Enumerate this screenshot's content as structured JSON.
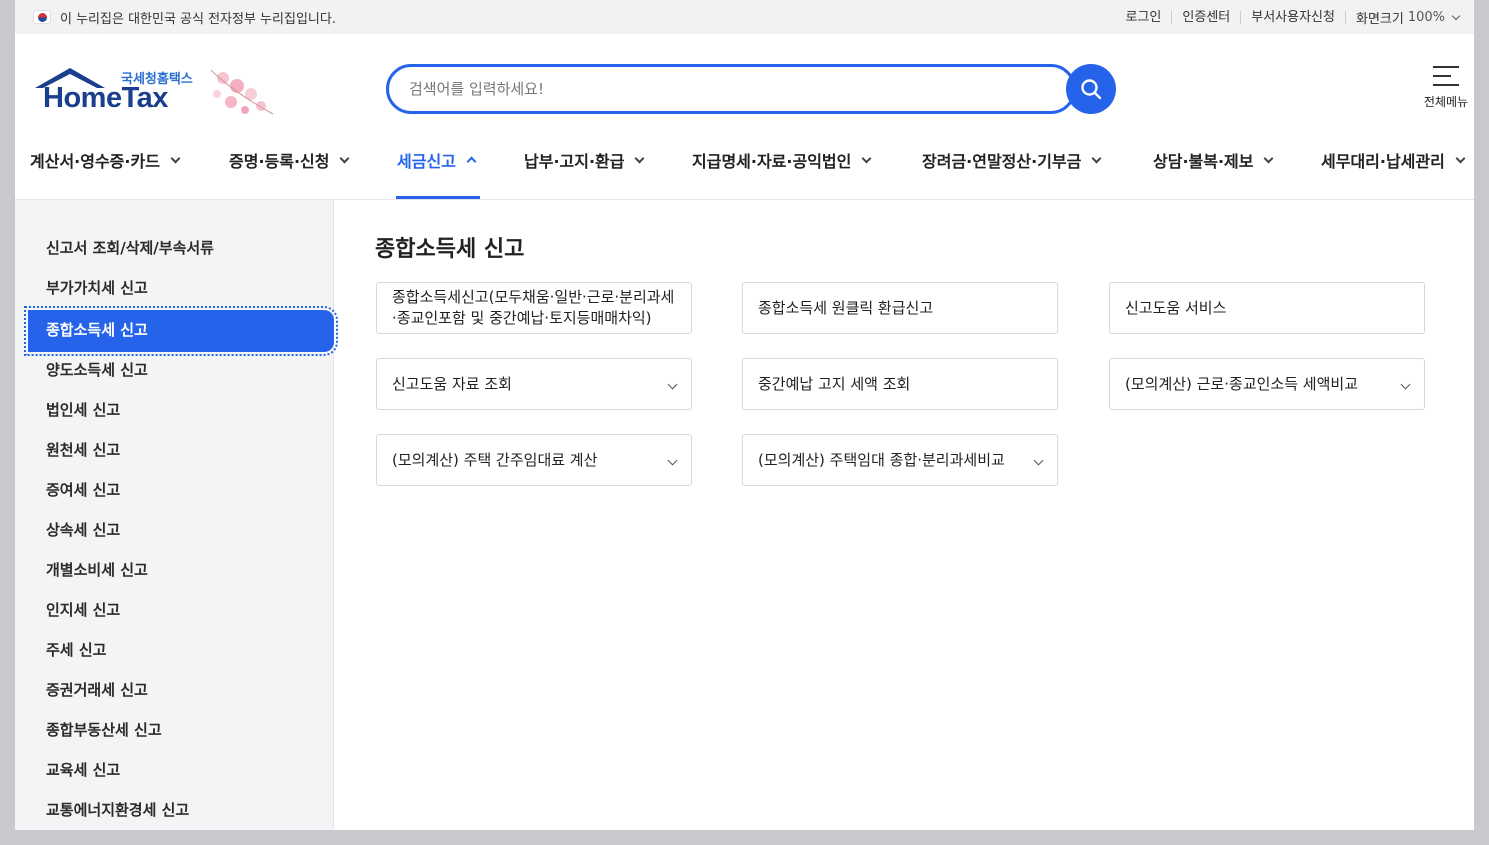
{
  "gov_notice": "이 누리집은 대한민국 공식 전자정부 누리집입니다.",
  "util_links": [
    "로그인",
    "인증센터",
    "부서사용자신청"
  ],
  "zoom": {
    "label": "화면크기",
    "value": "100%"
  },
  "logo": {
    "kr": "국세청홈택스",
    "en": "HomeTax"
  },
  "search": {
    "placeholder": "검색어를 입력하세요!"
  },
  "all_menu_label": "전체메뉴",
  "gnb": [
    {
      "label": "계산서·영수증·카드"
    },
    {
      "label": "증명·등록·신청"
    },
    {
      "label": "세금신고",
      "active": true
    },
    {
      "label": "납부·고지·환급"
    },
    {
      "label": "지급명세·자료·공익법인"
    },
    {
      "label": "장려금·연말정산·기부금"
    },
    {
      "label": "상담·불복·제보"
    },
    {
      "label": "세무대리·납세관리"
    }
  ],
  "lnb": [
    "신고서 조회/삭제/부속서류",
    "부가가치세 신고",
    "종합소득세 신고",
    "양도소득세 신고",
    "법인세 신고",
    "원천세 신고",
    "증여세 신고",
    "상속세 신고",
    "개별소비세 신고",
    "인지세 신고",
    "주세 신고",
    "증권거래세 신고",
    "종합부동산세 신고",
    "교육세 신고",
    "교통에너지환경세 신고"
  ],
  "lnb_active_index": 2,
  "content": {
    "title": "종합소득세 신고",
    "cards": [
      {
        "label": "종합소득세신고(모두채움·일반·근로·분리과세·종교인포함 및 중간예납·토지등매매차익)",
        "dropdown": false
      },
      {
        "label": "종합소득세 원클릭 환급신고",
        "dropdown": false
      },
      {
        "label": "신고도움 서비스",
        "dropdown": false
      },
      {
        "label": "신고도움 자료 조회",
        "dropdown": true
      },
      {
        "label": "중간예납 고지 세액 조회",
        "dropdown": false
      },
      {
        "label": "(모의계산) 근로·종교인소득 세액비교",
        "dropdown": true
      },
      {
        "label": "(모의계산) 주택 간주임대료 계산",
        "dropdown": true
      },
      {
        "label": "(모의계산) 주택임대 종합·분리과세비교",
        "dropdown": true
      }
    ]
  },
  "colors": {
    "primary": "#2563eb",
    "logo_navy": "#1a3f8c"
  },
  "icons": [
    "korea-flag-icon",
    "search-icon",
    "hamburger-menu-icon",
    "chevron-down-icon",
    "chevron-up-icon"
  ]
}
